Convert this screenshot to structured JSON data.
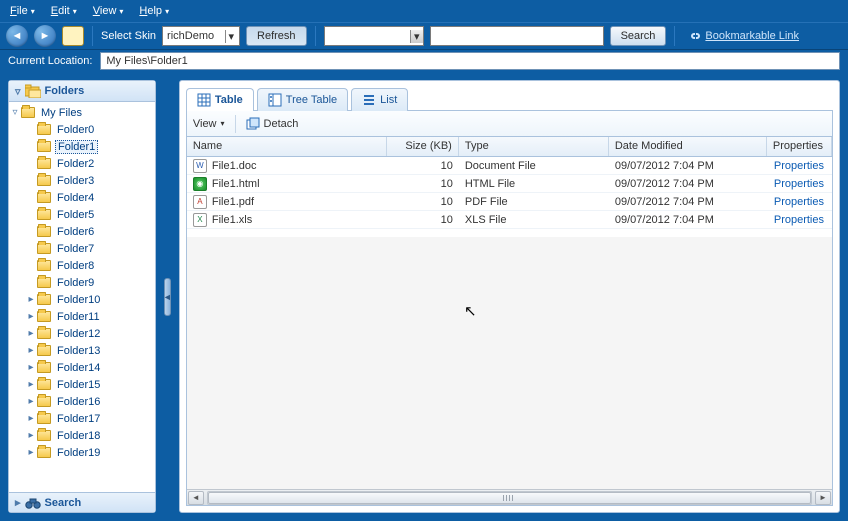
{
  "menu": {
    "file": "File",
    "edit": "Edit",
    "view": "View",
    "help": "Help"
  },
  "toolbar": {
    "selectSkin": "Select Skin",
    "skinValue": "richDemo",
    "refresh": "Refresh",
    "search": "Search",
    "bookmarkable": "Bookmarkable Link"
  },
  "location": {
    "label": "Current Location:",
    "value": "My Files\\Folder1"
  },
  "sidebar": {
    "foldersTitle": "Folders",
    "searchTitle": "Search",
    "root": "My Files",
    "selected": "Folder1",
    "items": [
      {
        "label": "Folder0",
        "expandable": false
      },
      {
        "label": "Folder1",
        "expandable": false
      },
      {
        "label": "Folder2",
        "expandable": false
      },
      {
        "label": "Folder3",
        "expandable": false
      },
      {
        "label": "Folder4",
        "expandable": false
      },
      {
        "label": "Folder5",
        "expandable": false
      },
      {
        "label": "Folder6",
        "expandable": false
      },
      {
        "label": "Folder7",
        "expandable": false
      },
      {
        "label": "Folder8",
        "expandable": false
      },
      {
        "label": "Folder9",
        "expandable": false
      },
      {
        "label": "Folder10",
        "expandable": true
      },
      {
        "label": "Folder11",
        "expandable": true
      },
      {
        "label": "Folder12",
        "expandable": true
      },
      {
        "label": "Folder13",
        "expandable": true
      },
      {
        "label": "Folder14",
        "expandable": true
      },
      {
        "label": "Folder15",
        "expandable": true
      },
      {
        "label": "Folder16",
        "expandable": true
      },
      {
        "label": "Folder17",
        "expandable": true
      },
      {
        "label": "Folder18",
        "expandable": true
      },
      {
        "label": "Folder19",
        "expandable": true
      }
    ]
  },
  "tabs": {
    "table": "Table",
    "treeTable": "Tree Table",
    "list": "List"
  },
  "subbar": {
    "view": "View",
    "detach": "Detach"
  },
  "grid": {
    "headers": {
      "name": "Name",
      "size": "Size (KB)",
      "type": "Type",
      "date": "Date Modified",
      "prop": "Properties"
    },
    "rows": [
      {
        "icon": "doc",
        "name": "File1.doc",
        "size": "10",
        "type": "Document File",
        "date": "09/07/2012 7:04 PM",
        "prop": "Properties"
      },
      {
        "icon": "html",
        "name": "File1.html",
        "size": "10",
        "type": "HTML File",
        "date": "09/07/2012 7:04 PM",
        "prop": "Properties"
      },
      {
        "icon": "pdf",
        "name": "File1.pdf",
        "size": "10",
        "type": "PDF File",
        "date": "09/07/2012 7:04 PM",
        "prop": "Properties"
      },
      {
        "icon": "xls",
        "name": "File1.xls",
        "size": "10",
        "type": "XLS File",
        "date": "09/07/2012 7:04 PM",
        "prop": "Properties"
      }
    ]
  }
}
